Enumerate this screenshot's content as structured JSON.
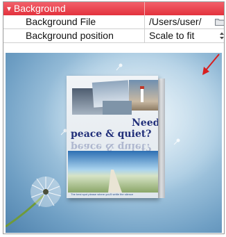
{
  "section": {
    "title": "Background",
    "expanded": true
  },
  "properties": [
    {
      "label": "Background File",
      "value": "/Users/user/",
      "control": "folder-icon"
    },
    {
      "label": "Background position",
      "value": "Scale to fit",
      "control": "stepper-icon"
    }
  ],
  "cover": {
    "title_line1": "Need",
    "title_line2": "peace & quiet?",
    "reflection": "peace & quiet?",
    "footer": "The best spot please where you'll settle the silence"
  },
  "colors": {
    "section_header": "#e3323d",
    "arrow": "#d81e1e",
    "cover_title": "#22307a"
  }
}
